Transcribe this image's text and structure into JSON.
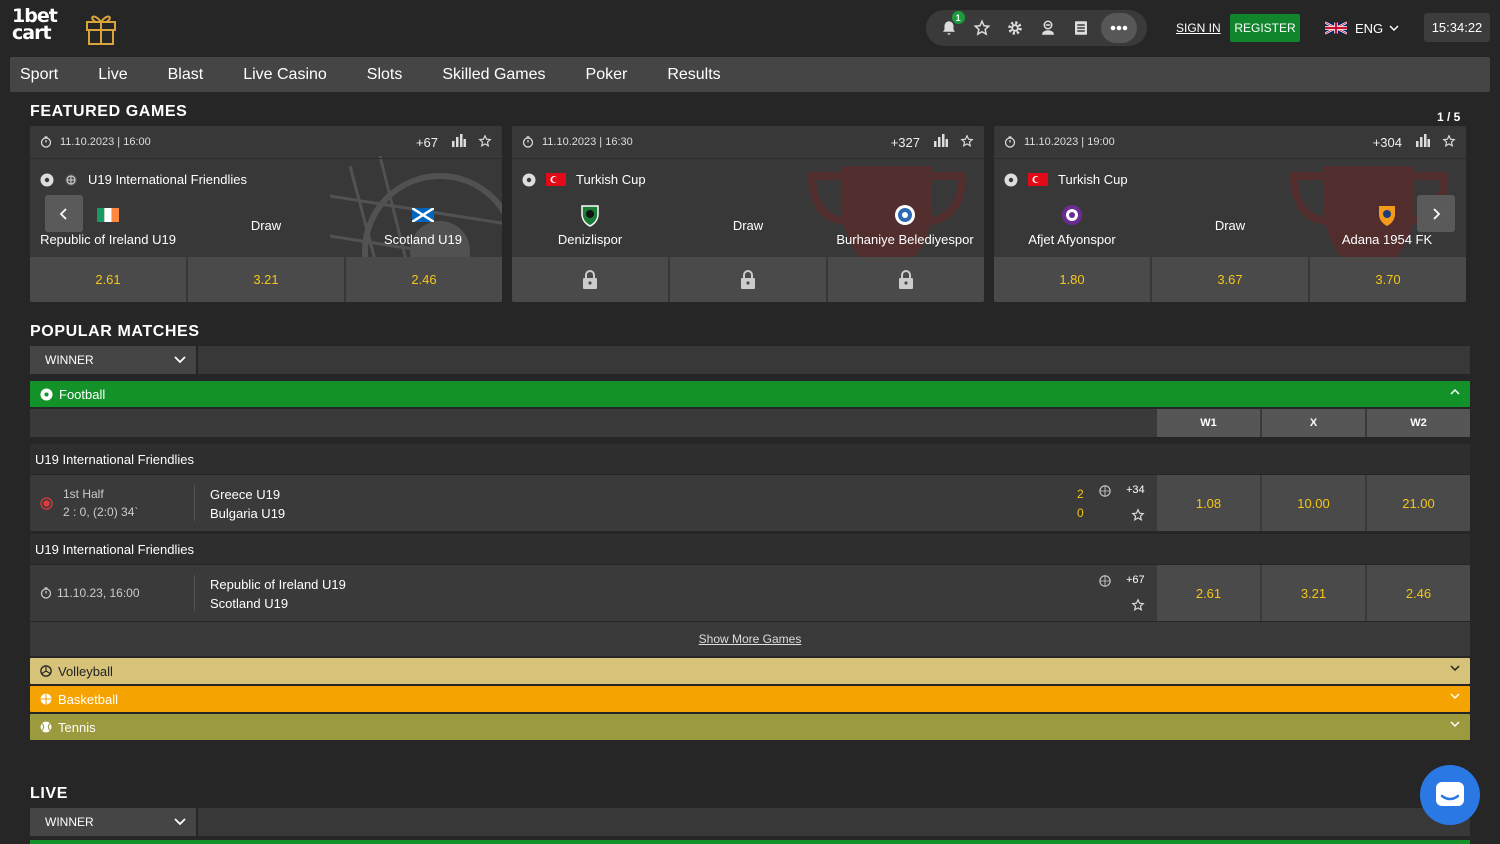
{
  "header": {
    "logo_line1": "1bet",
    "logo_line2": "cart",
    "notif_count": "1",
    "signin": "SIGN IN",
    "register": "REGISTER",
    "lang": "ENG",
    "time": "15:34:22"
  },
  "nav": [
    "Sport",
    "Live",
    "Blast",
    "Live Casino",
    "Slots",
    "Skilled Games",
    "Poker",
    "Results"
  ],
  "featured": {
    "title": "FEATURED GAMES",
    "pager": "1 / 5",
    "cards": [
      {
        "datetime": "11.10.2023 | 16:00",
        "count": "+67",
        "competition": "U19 International Friendlies",
        "home": "Republic of Ireland U19",
        "draw": "Draw",
        "away": "Scotland U19",
        "odds": [
          "2.61",
          "3.21",
          "2.46"
        ]
      },
      {
        "datetime": "11.10.2023 | 16:30",
        "count": "+327",
        "competition": "Turkish Cup",
        "home": "Denizlispor",
        "draw": "Draw",
        "away": "Burhaniye Belediyespor",
        "odds": [
          "locked",
          "locked",
          "locked"
        ]
      },
      {
        "datetime": "11.10.2023 | 19:00",
        "count": "+304",
        "competition": "Turkish Cup",
        "home": "Afjet Afyonspor",
        "draw": "Draw",
        "away": "Adana 1954 FK",
        "odds": [
          "1.80",
          "3.67",
          "3.70"
        ]
      }
    ]
  },
  "popular": {
    "title": "POPULAR MATCHES",
    "market": "WINNER",
    "sport": "Football",
    "columns": [
      "W1",
      "X",
      "W2"
    ],
    "groups": [
      {
        "competition": "U19 International Friendlies",
        "status": "1st Half",
        "score_detail": "2 : 0, (2:0) 34`",
        "home": "Greece U19",
        "away": "Bulgaria U19",
        "home_score": "2",
        "away_score": "0",
        "more": "+34",
        "odds": [
          "1.08",
          "10.00",
          "21.00"
        ]
      },
      {
        "competition": "U19 International Friendlies",
        "time": "11.10.23, 16:00",
        "home": "Republic of Ireland U19",
        "away": "Scotland U19",
        "more": "+67",
        "odds": [
          "2.61",
          "3.21",
          "2.46"
        ]
      }
    ],
    "show_more": "Show More Games",
    "other_sports": [
      {
        "name": "Volleyball",
        "color": "#d7c27a"
      },
      {
        "name": "Basketball",
        "color": "#f5a300"
      },
      {
        "name": "Tennis",
        "color": "#9c9a3e"
      }
    ]
  },
  "live": {
    "title": "LIVE",
    "market": "WINNER"
  },
  "colors": {
    "accent_green": "#11852c",
    "odds_yellow": "#f5c518",
    "football_green": "#14922a"
  }
}
